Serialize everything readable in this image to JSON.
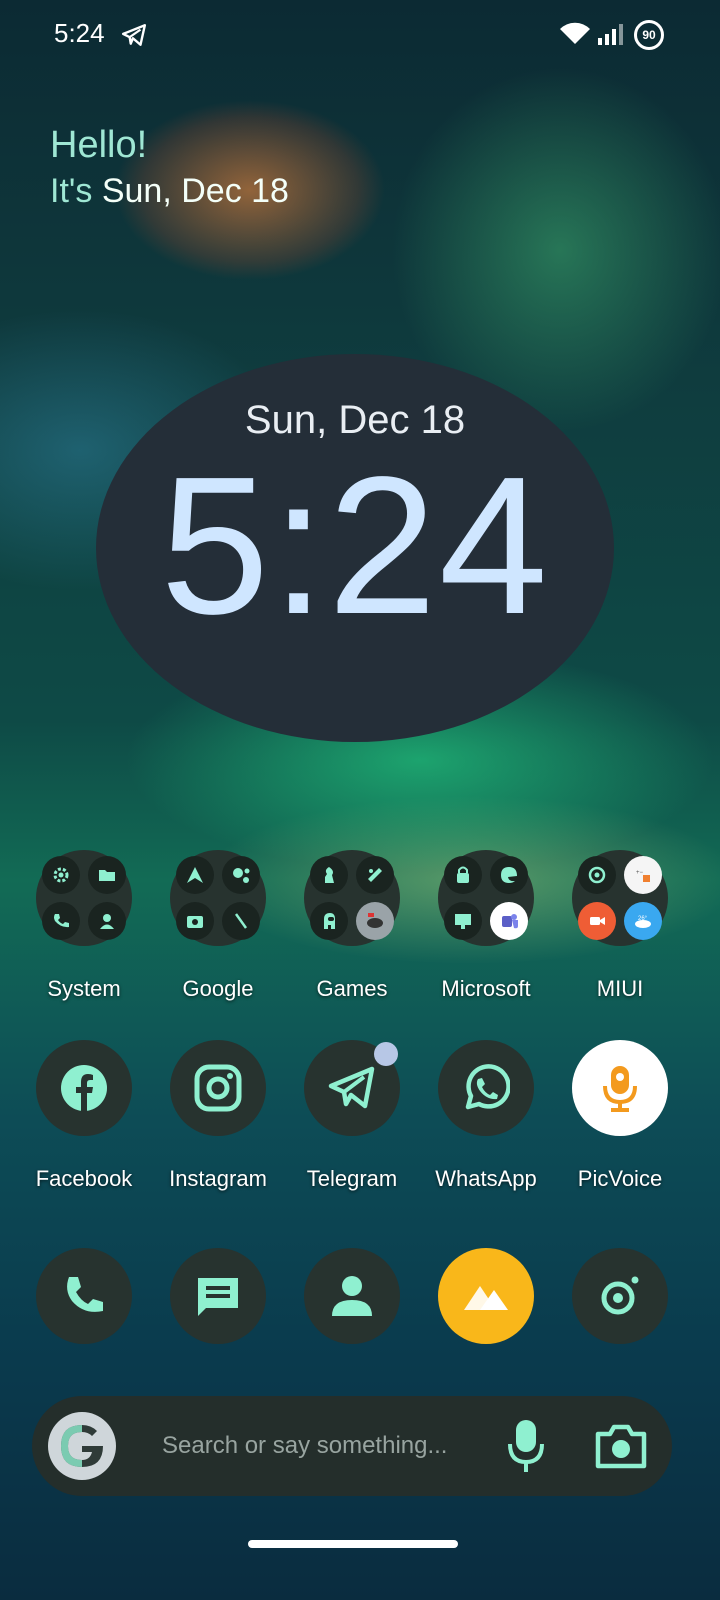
{
  "status": {
    "time": "5:24",
    "battery": "90"
  },
  "greeting": {
    "hello": "Hello!",
    "prefix": "It's ",
    "date": "Sun, Dec 18"
  },
  "clock": {
    "date": "Sun, Dec 18",
    "time": "5:24"
  },
  "folders": [
    {
      "label": "System"
    },
    {
      "label": "Google"
    },
    {
      "label": "Games"
    },
    {
      "label": "Microsoft"
    },
    {
      "label": "MIUI"
    }
  ],
  "apps": [
    {
      "label": "Facebook"
    },
    {
      "label": "Instagram"
    },
    {
      "label": "Telegram"
    },
    {
      "label": "WhatsApp"
    },
    {
      "label": "PicVoice"
    }
  ],
  "search": {
    "placeholder": "Search or say something..."
  },
  "colors": {
    "accent": "#8ff0d0",
    "widget": "#242e38",
    "clockText": "#cfe6ff",
    "gallery": "#f9b71a"
  }
}
